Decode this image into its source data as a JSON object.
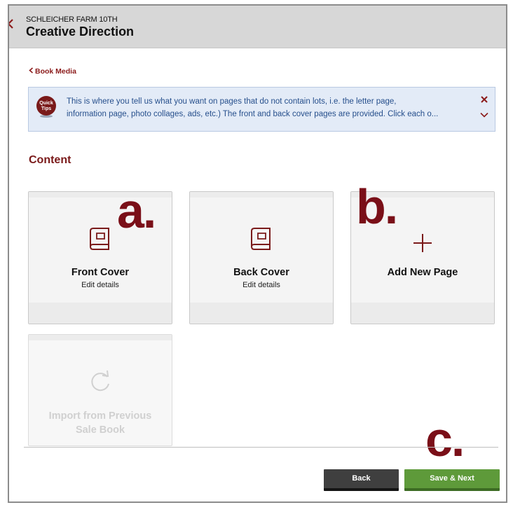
{
  "header": {
    "subtitle": "SCHLEICHER FARM 10TH",
    "title": "Creative Direction"
  },
  "breadcrumb": {
    "label": "Book Media"
  },
  "quick_tips": {
    "badge_line1": "Quick",
    "badge_line2": "Tips",
    "line1": "This is where you tell us what you want on pages that do not contain lots, i.e. the letter page,",
    "line2": "information page, photo collages, ads, etc.) The front and back cover pages are provided. Click each o..."
  },
  "content": {
    "heading": "Content",
    "cards": [
      {
        "title": "Front Cover",
        "subtitle": "Edit details",
        "icon": "book-icon"
      },
      {
        "title": "Back Cover",
        "subtitle": "Edit details",
        "icon": "book-icon"
      },
      {
        "title": "Add New Page",
        "subtitle": "",
        "icon": "plus-icon"
      },
      {
        "title_line1": "Import from Previous",
        "title_line2": "Sale Book",
        "icon": "refresh-icon",
        "disabled": true
      }
    ]
  },
  "annotations": [
    "a.",
    "b.",
    "c."
  ],
  "footer": {
    "back_label": "Back",
    "next_label": "Save & Next"
  },
  "colors": {
    "brand": "#7a1a1a",
    "tips_bg": "#e3ebf7",
    "tips_text": "#264f8c",
    "back_button": "#3f3f3f",
    "next_button": "#5e9a3a",
    "annotation": "#7a0f18"
  }
}
